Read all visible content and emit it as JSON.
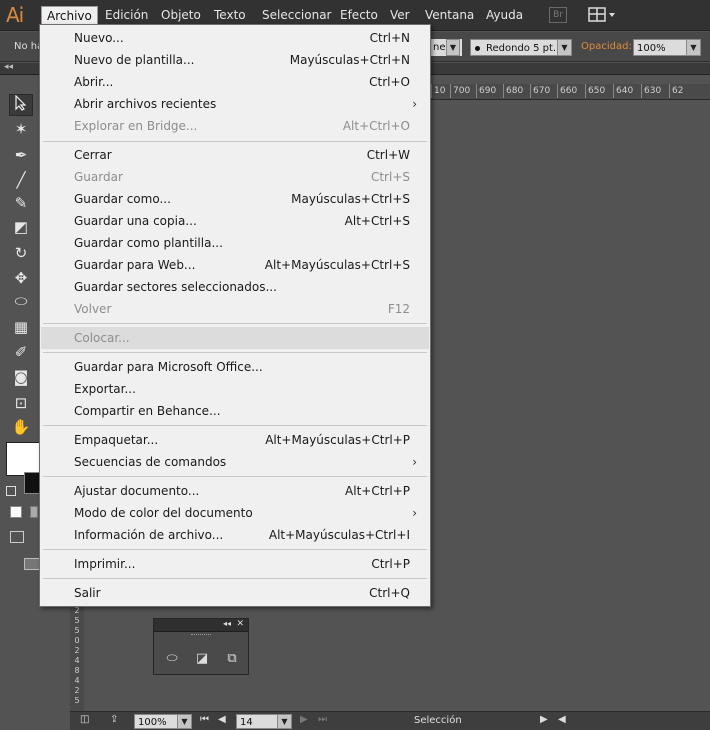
{
  "app": {
    "logo": "Ai"
  },
  "menubar": {
    "items": [
      "Archivo",
      "Edición",
      "Objeto",
      "Texto",
      "Seleccionar",
      "Efecto",
      "Ver",
      "Ventana",
      "Ayuda"
    ],
    "bridge_badge": "Br"
  },
  "controlbar": {
    "selection_label": "No ha",
    "stroke_value": "ne",
    "brush_label": "Redondo 5 pt.",
    "opacity_label": "Opacidad:",
    "opacity_value": "100%"
  },
  "ruler": {
    "top_ticks": [
      "10",
      "700",
      "690",
      "680",
      "670",
      "660",
      "650",
      "640",
      "630",
      "62"
    ],
    "left_ticks": [
      "2",
      "5",
      "5",
      "0",
      "2",
      "4",
      "8",
      "4",
      "2",
      "5"
    ]
  },
  "file_menu": {
    "items": [
      {
        "label": "Nuevo...",
        "shortcut": "Ctrl+N",
        "enabled": true
      },
      {
        "label": "Nuevo de plantilla...",
        "shortcut": "Mayúsculas+Ctrl+N",
        "enabled": true
      },
      {
        "label": "Abrir...",
        "shortcut": "Ctrl+O",
        "enabled": true
      },
      {
        "label": "Abrir archivos recientes",
        "shortcut": "",
        "submenu": true,
        "enabled": true
      },
      {
        "label": "Explorar en Bridge...",
        "shortcut": "Alt+Ctrl+O",
        "enabled": false
      },
      {
        "label": "Cerrar",
        "shortcut": "Ctrl+W",
        "enabled": true
      },
      {
        "label": "Guardar",
        "shortcut": "Ctrl+S",
        "enabled": false
      },
      {
        "label": "Guardar como...",
        "shortcut": "Mayúsculas+Ctrl+S",
        "enabled": true
      },
      {
        "label": "Guardar una copia...",
        "shortcut": "Alt+Ctrl+S",
        "enabled": true
      },
      {
        "label": "Guardar como plantilla...",
        "shortcut": "",
        "enabled": true
      },
      {
        "label": "Guardar para Web...",
        "shortcut": "Alt+Mayúsculas+Ctrl+S",
        "enabled": true
      },
      {
        "label": "Guardar sectores seleccionados...",
        "shortcut": "",
        "enabled": true
      },
      {
        "label": "Volver",
        "shortcut": "F12",
        "enabled": false
      },
      {
        "label": "Colocar...",
        "shortcut": "",
        "enabled": false,
        "highlighted": true
      },
      {
        "label": "Guardar para Microsoft Office...",
        "shortcut": "",
        "enabled": true
      },
      {
        "label": "Exportar...",
        "shortcut": "",
        "enabled": true
      },
      {
        "label": "Compartir en Behance...",
        "shortcut": "",
        "enabled": true
      },
      {
        "label": "Empaquetar...",
        "shortcut": "Alt+Mayúsculas+Ctrl+P",
        "enabled": true
      },
      {
        "label": "Secuencias de comandos",
        "shortcut": "",
        "submenu": true,
        "enabled": true
      },
      {
        "label": "Ajustar documento...",
        "shortcut": "Alt+Ctrl+P",
        "enabled": true
      },
      {
        "label": "Modo de color del documento",
        "shortcut": "",
        "submenu": true,
        "enabled": true
      },
      {
        "label": "Información de archivo...",
        "shortcut": "Alt+Mayúsculas+Ctrl+I",
        "enabled": true
      },
      {
        "label": "Imprimir...",
        "shortcut": "Ctrl+P",
        "enabled": true
      },
      {
        "label": "Salir",
        "shortcut": "Ctrl+Q",
        "enabled": true
      }
    ],
    "submenu_glyph": "›"
  },
  "statusbar": {
    "zoom": "100%",
    "page": "14",
    "status_text": "Selección"
  }
}
